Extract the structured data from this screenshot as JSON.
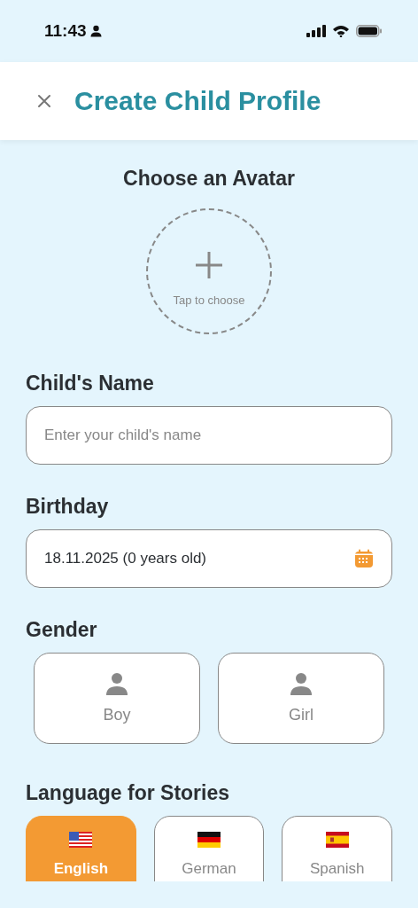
{
  "status_bar": {
    "time": "11:43"
  },
  "header": {
    "title": "Create Child Profile"
  },
  "avatar": {
    "heading": "Choose an Avatar",
    "hint": "Tap to choose"
  },
  "name_field": {
    "label": "Child's Name",
    "placeholder": "Enter your child's name"
  },
  "birthday_field": {
    "label": "Birthday",
    "value": "18.11.2025 (0 years old)"
  },
  "gender": {
    "label": "Gender",
    "options": [
      {
        "label": "Boy",
        "selected": false
      },
      {
        "label": "Girl",
        "selected": false
      }
    ]
  },
  "language": {
    "label": "Language for Stories",
    "options": [
      {
        "label": "English",
        "selected": true
      },
      {
        "label": "German",
        "selected": false
      },
      {
        "label": "Spanish",
        "selected": false
      }
    ]
  }
}
